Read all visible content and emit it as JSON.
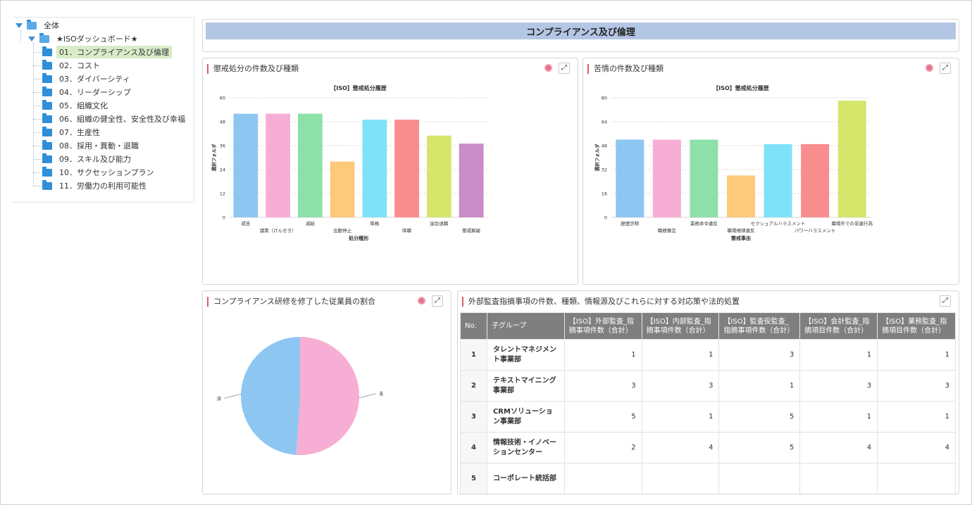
{
  "tree": {
    "root": "全体",
    "dashboard": "★ISOダッシュボード★",
    "items": [
      {
        "label": "01．コンプライアンス及び倫理",
        "selected": true
      },
      {
        "label": "02．コスト"
      },
      {
        "label": "03．ダイバーシティ"
      },
      {
        "label": "04．リーダーシップ"
      },
      {
        "label": "05．組織文化"
      },
      {
        "label": "06．組織の健全性、安全性及び幸福"
      },
      {
        "label": "07．生産性"
      },
      {
        "label": "08．採用・異動・退職"
      },
      {
        "label": "09．スキル及び能力"
      },
      {
        "label": "10．サクセッションプラン"
      },
      {
        "label": "11．労働力の利用可能性"
      }
    ]
  },
  "header": {
    "title": "コンプライアンス及び倫理"
  },
  "panels": {
    "discipline": {
      "title": "懲戒処分の件数及び種類"
    },
    "grievance": {
      "title": "苦情の件数及び種類"
    },
    "training": {
      "title": "コンプライアンス研修を修了した従業員の割合"
    },
    "audit": {
      "title": "外部監査指摘事項の件数、種類、情報源及びこれらに対する対応策や法的処置"
    }
  },
  "icons": {
    "expand": "expand-icon",
    "clock": "clock-icon",
    "folder": "folder-icon",
    "toggle": "triangle-down-icon"
  },
  "colors": {
    "palette": [
      "#8ec6f2",
      "#f7aed4",
      "#8ee0a9",
      "#fdc97a",
      "#7fe2f8",
      "#f98d8d",
      "#d4e56a",
      "#c98cc8"
    ],
    "header_bg": "#b3c6e4",
    "selected_bg": "#d8ecc8",
    "title_accent": "#e05a6a",
    "table_head_bg": "#7f7f7f"
  },
  "chart_data": [
    {
      "type": "bar",
      "title": "【ISO】懲戒処分履歴",
      "xlabel": "処分種別",
      "ylabel": "選択フォルダ",
      "categories": [
        "戒告",
        "譴責（けんせき）",
        "減給",
        "出勤停止",
        "降格",
        "降職",
        "諭旨退職",
        "懲戒解雇"
      ],
      "values": [
        52,
        52,
        52,
        28,
        49,
        49,
        41,
        37
      ],
      "ylim": [
        0,
        60
      ],
      "yticks": [
        "0",
        "12",
        "24",
        "36",
        "48",
        "60"
      ],
      "grid": true
    },
    {
      "type": "bar",
      "title": "【ISO】懲戒処分履歴",
      "xlabel": "懲戒事由",
      "ylabel": "選択フォルダ",
      "categories": [
        "経歴詐称",
        "職務懈怠",
        "業務命令違反",
        "職場規律違反",
        "セクシュアルハラスメント",
        "パワーハラスメント",
        "職場外での非違行為"
      ],
      "values": [
        52,
        52,
        52,
        28,
        49,
        49,
        78
      ],
      "ylim": [
        0,
        80
      ],
      "yticks": [
        "0",
        "16",
        "32",
        "48",
        "64",
        "80"
      ],
      "grid": true
    },
    {
      "type": "pie",
      "labels": [
        "未",
        "済"
      ],
      "values": [
        51,
        49
      ]
    }
  ],
  "table": {
    "headers": [
      "No.",
      "子グループ",
      "【ISO】外部監査_指摘事項件数（合計）",
      "【ISO】内部監査_指摘事項件数（合計）",
      "【ISO】監査役監査_指摘事項件数（合計）",
      "【ISO】会計監査_指摘項目件数（合計）",
      "【ISO】業務監査_指摘項目件数（合計）"
    ],
    "rows": [
      {
        "no": "1",
        "group": "タレントマネジメント事業部",
        "c1": "1",
        "c2": "1",
        "c3": "3",
        "c4": "1",
        "c5": "1"
      },
      {
        "no": "2",
        "group": "テキストマイニング事業部",
        "c1": "3",
        "c2": "3",
        "c3": "1",
        "c4": "3",
        "c5": "3"
      },
      {
        "no": "3",
        "group": "CRMソリューション事業部",
        "c1": "5",
        "c2": "1",
        "c3": "5",
        "c4": "1",
        "c5": "1"
      },
      {
        "no": "4",
        "group": "情報技術・イノベーションセンター",
        "c1": "2",
        "c2": "4",
        "c3": "5",
        "c4": "4",
        "c5": "4"
      },
      {
        "no": "5",
        "group": "コーポレート統括部",
        "c1": "",
        "c2": "",
        "c3": "",
        "c4": "",
        "c5": ""
      }
    ]
  }
}
